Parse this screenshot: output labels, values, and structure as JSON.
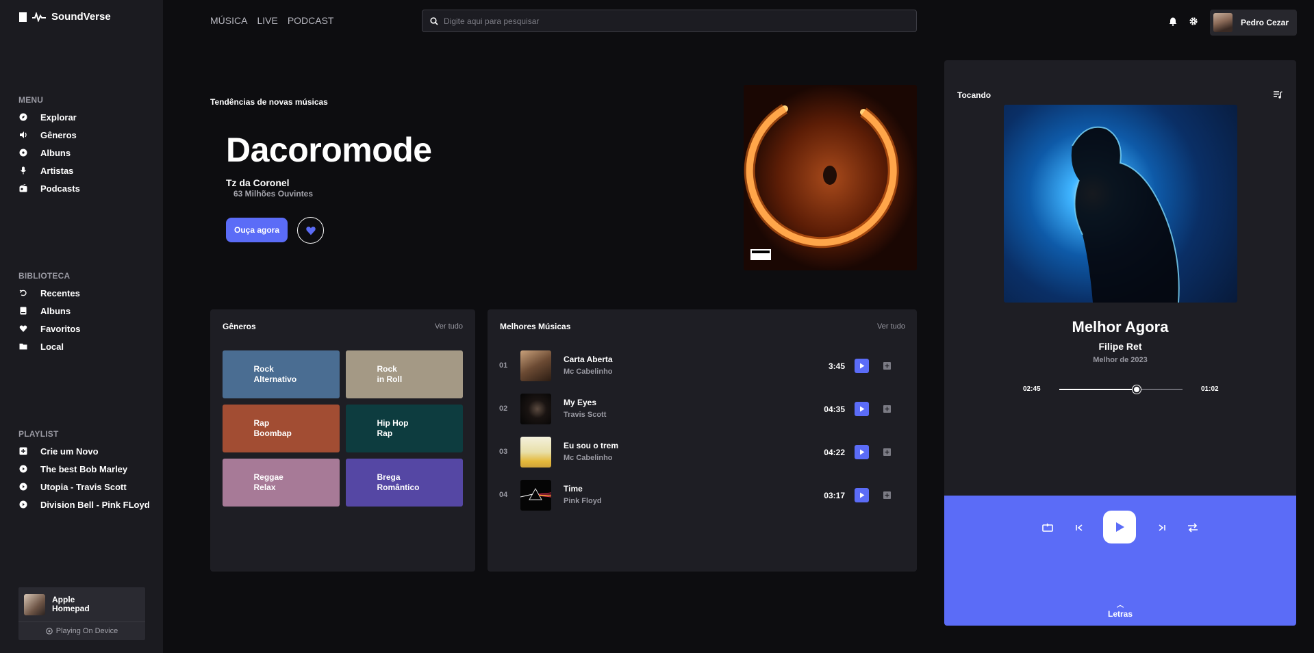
{
  "brand": {
    "name": "SoundVerse"
  },
  "sidebar": {
    "menu_title": "MENU",
    "menu": [
      {
        "label": "Explorar",
        "icon": "compass-icon"
      },
      {
        "label": "Gêneros",
        "icon": "speaker-icon"
      },
      {
        "label": "Albuns",
        "icon": "album-icon"
      },
      {
        "label": "Artistas",
        "icon": "microphone-icon"
      },
      {
        "label": "Podcasts",
        "icon": "radio-icon"
      }
    ],
    "library_title": "BIBLIOTECA",
    "library": [
      {
        "label": "Recentes",
        "icon": "history-icon"
      },
      {
        "label": "Albuns",
        "icon": "book-icon"
      },
      {
        "label": "Favoritos",
        "icon": "heart-icon"
      },
      {
        "label": "Local",
        "icon": "folder-icon"
      }
    ],
    "playlist_title": "PLAYLIST",
    "playlists": [
      {
        "label": "Crie um Novo",
        "icon": "plus-square-icon"
      },
      {
        "label": "The best Bob Marley",
        "icon": "play-circle-icon"
      },
      {
        "label": "Utopia - Travis Scott",
        "icon": "play-circle-icon"
      },
      {
        "label": "Division Bell - Pink FLoyd",
        "icon": "play-circle-icon"
      }
    ],
    "device": {
      "name": "Apple Homepad",
      "status": "Playing On Device"
    }
  },
  "header": {
    "nav": [
      "MÚSICA",
      "LIVE",
      "PODCAST"
    ],
    "search_placeholder": "Digite aqui para pesquisar",
    "user_name": "Pedro Cezar"
  },
  "hero": {
    "label": "Tendências de novas músicas",
    "title": "Dacoromode",
    "artist": "Tz da Coronel",
    "listeners": "63 Milhões Ouvintes",
    "cta": "Ouça agora"
  },
  "genres": {
    "title": "Gêneros",
    "link": "Ver tudo",
    "items": [
      {
        "label": "Rock\nAlternativo",
        "color": "#4a6d92"
      },
      {
        "label": "Rock\nin Roll",
        "color": "#a49985"
      },
      {
        "label": "Rap\nBoombap",
        "color": "#a24d33"
      },
      {
        "label": "Hip Hop\nRap",
        "color": "#0d3c3f"
      },
      {
        "label": "Reggae\nRelax",
        "color": "#a77a97"
      },
      {
        "label": "Brega\nRomântico",
        "color": "#5547a4"
      }
    ]
  },
  "top_tracks": {
    "title": "Melhores Músicas",
    "link": "Ver tudo",
    "items": [
      {
        "num": "01",
        "name": "Carta Aberta",
        "artist": "Mc Cabelinho",
        "duration": "3:45"
      },
      {
        "num": "02",
        "name": "My Eyes",
        "artist": "Travis Scott",
        "duration": "04:35"
      },
      {
        "num": "03",
        "name": "Eu sou o trem",
        "artist": "Mc Cabelinho",
        "duration": "04:22"
      },
      {
        "num": "04",
        "name": "Time",
        "artist": "Pink Floyd",
        "duration": "03:17"
      }
    ]
  },
  "now_playing": {
    "title": "Tocando",
    "song": "Melhor Agora",
    "artist": "Filipe Ret",
    "album": "Melhor de 2023",
    "current_time": "02:45",
    "end_time": "01:02",
    "progress": 0.63,
    "lyrics": "Letras"
  },
  "colors": {
    "accent": "#5b6cf7",
    "sidebar": "#1b1b20",
    "card": "#1e1e24",
    "bg": "#0d0d10"
  }
}
